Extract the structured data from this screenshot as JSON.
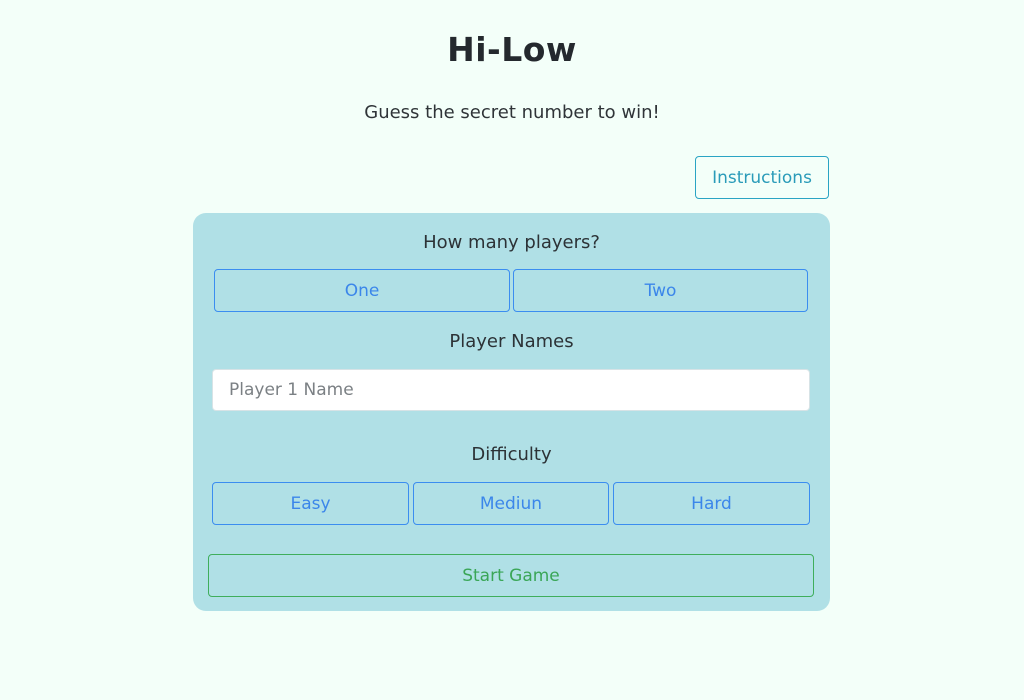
{
  "header": {
    "title": "Hi-Low",
    "subtitle": "Guess the secret number to win!"
  },
  "toolbar": {
    "instructions_label": "Instructions"
  },
  "setup": {
    "players": {
      "label": "How many players?",
      "options": [
        "One",
        "Two"
      ]
    },
    "names": {
      "label": "Player Names",
      "player1_placeholder": "Player 1 Name",
      "player1_value": ""
    },
    "difficulty": {
      "label": "Difficulty",
      "options": [
        "Easy",
        "Mediun",
        "Hard"
      ]
    },
    "start_label": "Start Game"
  },
  "colors": {
    "page_background": "#f3fff9",
    "card_background": "#b0e0e6",
    "primary_outline": "#3b8df0",
    "info_outline": "#2aa4c4",
    "success_outline": "#3fae5c"
  }
}
